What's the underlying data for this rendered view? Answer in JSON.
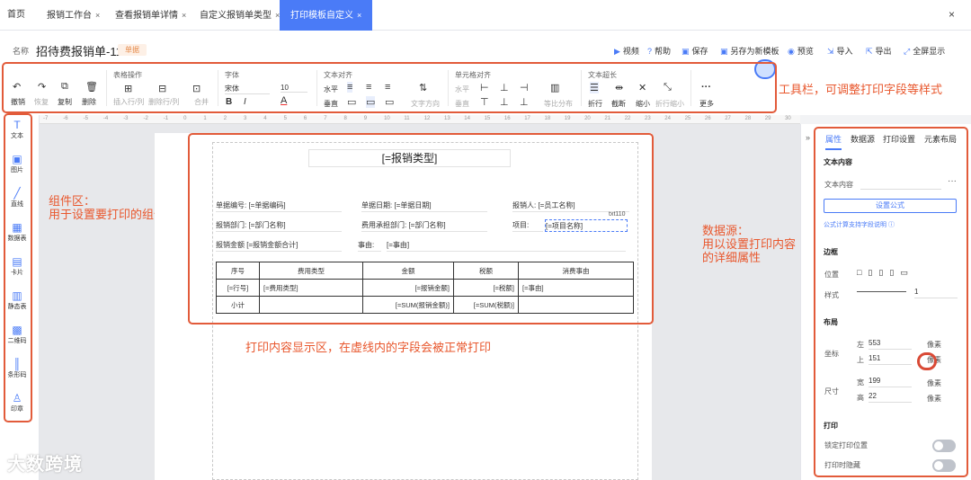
{
  "tabs": [
    {
      "label": "首页",
      "close": ""
    },
    {
      "label": "报销工作台",
      "close": "×"
    },
    {
      "label": "查看报销单详情",
      "close": "×"
    },
    {
      "label": "自定义报销单类型",
      "close": "×"
    },
    {
      "label": "打印模板自定义",
      "close": "×"
    }
  ],
  "close_all": "×",
  "header": {
    "name_label": "名称",
    "name": "招待费报销单-11",
    "badge": "单据",
    "actions": [
      "视频",
      "帮助",
      "保存",
      "另存为新模板",
      "预览",
      "导入",
      "导出",
      "全屏显示"
    ]
  },
  "toolbar": {
    "groups": [
      "表格操作",
      "字体",
      "文本对齐",
      "单元格对齐",
      "文本超长"
    ],
    "undo": "撤销",
    "redo": "恢复",
    "copy": "复制",
    "delete": "删除",
    "insert": "插入行/列",
    "remove_rows": "删除行/列",
    "merge": "合并",
    "font": "宋体",
    "size": "10",
    "bold": "B",
    "italic": "I",
    "h_align": "水平",
    "v_align": "垂直",
    "text_dir": "文字方向",
    "cell_h": "水平",
    "cell_v": "垂直",
    "even": "等比分布",
    "wrap": "折行",
    "cut": "截断",
    "shrink": "缩小",
    "wrap_shrink": "折行缩小",
    "more": "更多"
  },
  "annotations": {
    "toolbar": "工具栏，可调整打印字段等样式",
    "components": "组件区：\n用于设置要打印的组件",
    "display": "打印内容显示区，在虚线内的字段会被正常打印",
    "datasource": "数据源：\n用以设置打印内容\n的详细属性"
  },
  "ruler_ticks": [
    "-7",
    "-6",
    "-5",
    "-4",
    "-3",
    "-2",
    "-1",
    "0",
    "1",
    "2",
    "3",
    "4",
    "5",
    "6",
    "7",
    "8",
    "9",
    "10",
    "11",
    "12",
    "13",
    "14",
    "15",
    "16",
    "17",
    "18",
    "19",
    "20",
    "21",
    "22",
    "23",
    "24",
    "25",
    "26",
    "27",
    "28",
    "29",
    "30"
  ],
  "components": [
    {
      "label": "文本",
      "icon": "T"
    },
    {
      "label": "图片",
      "icon": "▣"
    },
    {
      "label": "直线",
      "icon": "╱"
    },
    {
      "label": "数据表",
      "icon": "▦"
    },
    {
      "label": "卡片",
      "icon": "▤"
    },
    {
      "label": "静态表",
      "icon": "▥"
    },
    {
      "label": "二维码",
      "icon": "▩"
    },
    {
      "label": "条形码",
      "icon": "║"
    },
    {
      "label": "印章",
      "icon": "♙"
    }
  ],
  "template": {
    "title": "[=报销类型]",
    "fields": [
      "单据编号: [=单据编码]",
      "单据日期: [=单据日期]",
      "报销人: [=员工名称]",
      "报销部门: [=部门名称]",
      "费用承担部门: [=部门名称]",
      "项目:",
      "[=项目名称]",
      "报销金额 [=报销金额合计]",
      "事由:",
      "[=事由]"
    ],
    "selected_tag": "txt110",
    "table": {
      "headers": [
        "序号",
        "费用类型",
        "金额",
        "税额",
        "消费事由"
      ],
      "rows": [
        [
          "[=行号]",
          "[=费用类型]",
          "[=报销金额]",
          "[=税额]",
          "[=事由]"
        ],
        [
          "小计",
          "",
          "[=SUM(报销金额)]",
          "[=SUM(税额)]",
          ""
        ]
      ]
    }
  },
  "right": {
    "tabs": [
      "属性",
      "数据源",
      "打印设置",
      "元素布局"
    ],
    "text_section": "文本内容",
    "text_label": "文本内容",
    "text_more": "···",
    "formula_btn": "设置公式",
    "formula_help": "公式计算支持字段说明",
    "border_section": "边框",
    "position": "位置",
    "style": "样式",
    "style_val": "1",
    "layout_section": "布局",
    "coord": "坐标",
    "left_lbl": "左",
    "left_val": "553",
    "top_lbl": "上",
    "top_val": "151",
    "size": "尺寸",
    "w_lbl": "宽",
    "w_val": "199",
    "h_lbl": "高",
    "h_val": "22",
    "unit": "像素",
    "print_section": "打印",
    "lock": "锁定打印位置",
    "hide": "打印时隐藏"
  },
  "watermark": "大数跨境"
}
